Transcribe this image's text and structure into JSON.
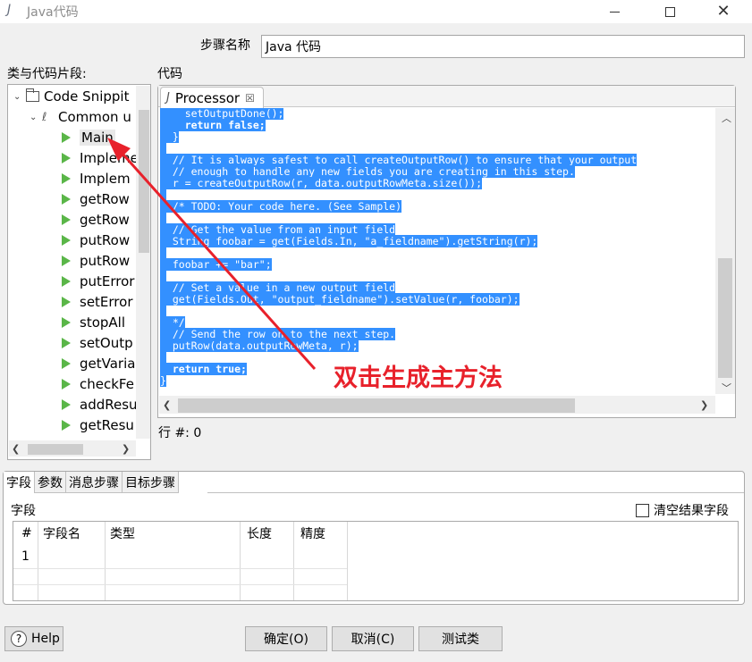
{
  "window": {
    "title": "Java代码"
  },
  "step": {
    "label": "步骤名称",
    "value": "Java 代码"
  },
  "left_panel": {
    "label": "类与代码片段:"
  },
  "code_panel": {
    "label": "代码"
  },
  "tree": {
    "root": "Code Snippit",
    "group": "Common u",
    "items": [
      "Main",
      "Impleme",
      "Implem",
      "getRow",
      "getRow",
      "putRow",
      "putRow",
      "putError",
      "setError",
      "stopAll",
      "setOutp",
      "getVaria",
      "checkFe",
      "addResu",
      "getResu"
    ]
  },
  "editor": {
    "tab": "Processor",
    "lines": [
      "    setOutputDone();",
      "    return false;",
      "  }",
      "",
      "  // It is always safest to call createOutputRow() to ensure that your output",
      "  // enough to handle any new fields you are creating in this step.",
      "  r = createOutputRow(r, data.outputRowMeta.size());",
      "",
      "  /* TODO: Your code here. (See Sample)",
      "",
      "  // Get the value from an input field",
      "  String foobar = get(Fields.In, \"a_fieldname\").getString(r);",
      "",
      "  foobar += \"bar\";",
      "",
      "  // Set a value in a new output field",
      "  get(Fields.Out, \"output_fieldname\").setValue(r, foobar);",
      "",
      "  */",
      "  // Send the row on to the next step.",
      "  putRow(data.outputRowMeta, r);",
      "",
      "  return true;",
      "}"
    ]
  },
  "status": {
    "row_count": "行 #: 0"
  },
  "bottom": {
    "tabs": [
      "字段",
      "参数",
      "消息步骤",
      "目标步骤"
    ],
    "fields_label": "字段",
    "clear_label": "清空结果字段",
    "columns": [
      "#",
      "字段名",
      "类型",
      "长度",
      "精度"
    ],
    "rows": [
      "1"
    ]
  },
  "buttons": {
    "help": "Help",
    "ok": "确定(O)",
    "cancel": "取消(C)",
    "test": "测试类"
  },
  "annotation": {
    "text": "双击生成主方法",
    "color": "#e8212b"
  },
  "icons": [
    "java-icon",
    "minimize-icon",
    "maximize-icon",
    "close-icon",
    "folder-icon",
    "paperclip-icon",
    "snippet-icon",
    "help-icon"
  ]
}
